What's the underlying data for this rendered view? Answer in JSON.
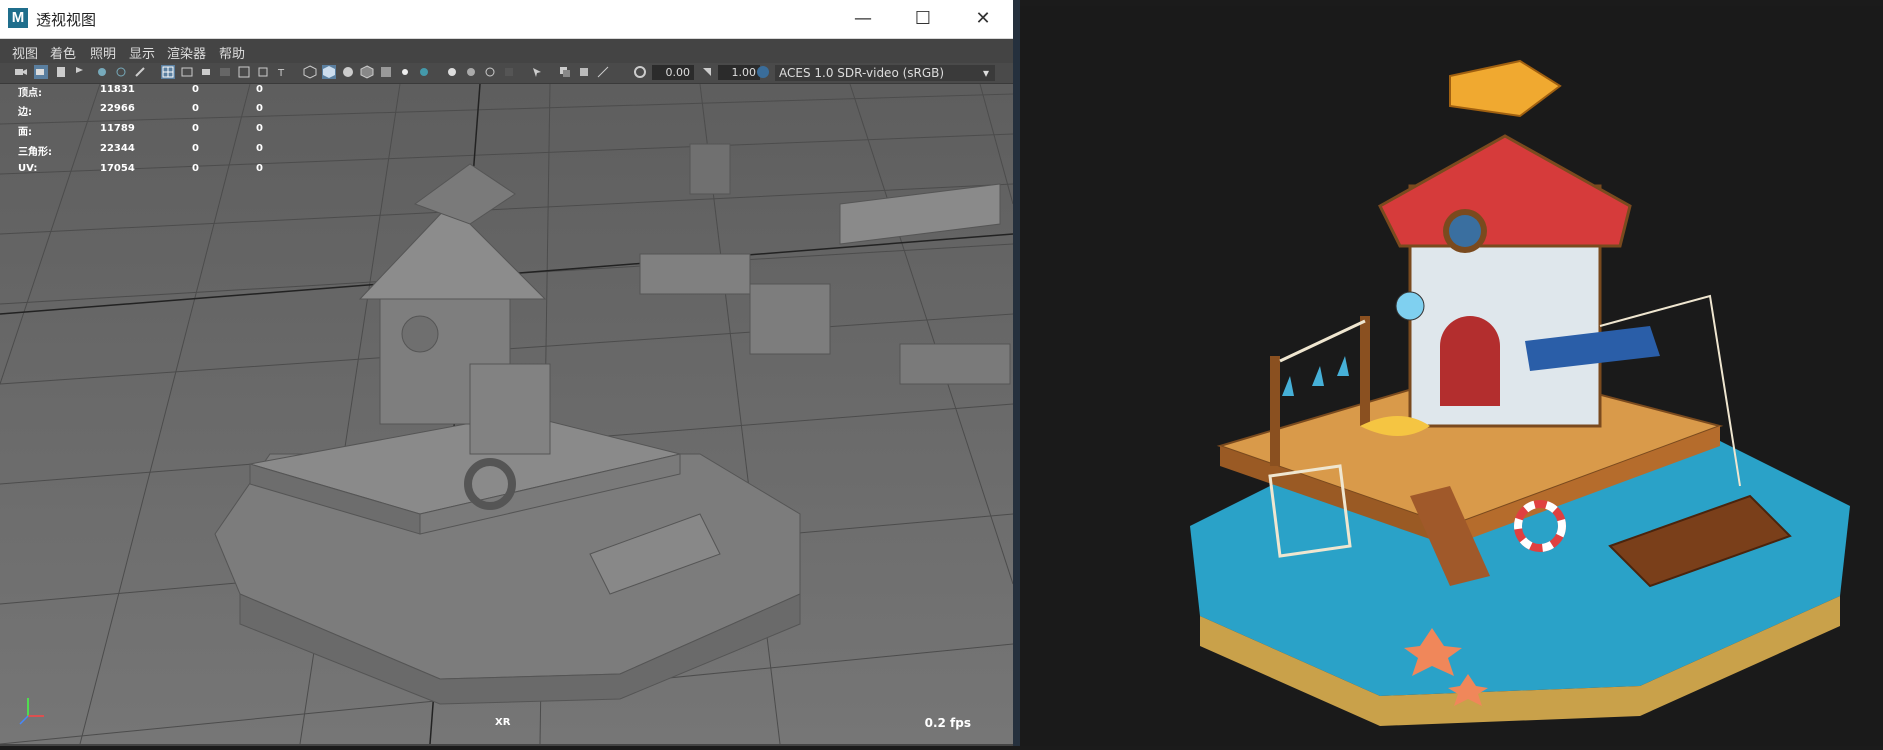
{
  "window": {
    "title": "透视视图",
    "app_icon": "M",
    "controls": {
      "minimize": "—",
      "maximize": "☐",
      "close": "✕"
    }
  },
  "menu": [
    "视图",
    "着色",
    "照明",
    "显示",
    "渲染器",
    "帮助"
  ],
  "toolbar": {
    "field1": "0.00",
    "field2": "1.00",
    "color_space": "ACES 1.0 SDR-video (sRGB)"
  },
  "hud": {
    "rows": [
      {
        "label": "顶点:",
        "v1": "11831",
        "v2": "0",
        "v3": "0"
      },
      {
        "label": "边:",
        "v1": "22966",
        "v2": "0",
        "v3": "0"
      },
      {
        "label": "面:",
        "v1": "11789",
        "v2": "0",
        "v3": "0"
      },
      {
        "label": "三角形:",
        "v1": "22344",
        "v2": "0",
        "v3": "0"
      },
      {
        "label": "UV:",
        "v1": "17054",
        "v2": "0",
        "v3": "0"
      }
    ],
    "xr": "XR",
    "fps": "0.2 fps"
  }
}
